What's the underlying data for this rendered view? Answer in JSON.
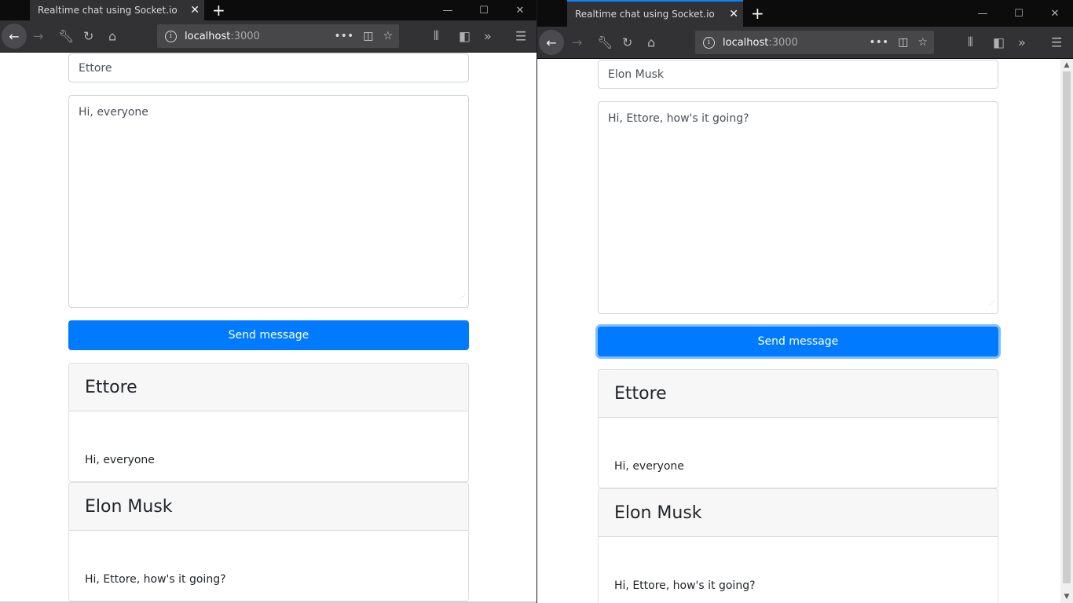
{
  "left_window": {
    "tab_title": "Realtime chat using Socket.io",
    "url_host": "localhost",
    "url_port": ":3000",
    "name_value": "Ettore",
    "message_value": "Hi, everyone",
    "send_label": "Send message",
    "messages": [
      {
        "name": "Ettore",
        "text": "Hi, everyone"
      },
      {
        "name": "Elon Musk",
        "text": "Hi, Ettore, how's it going?"
      }
    ]
  },
  "right_window": {
    "tab_title": "Realtime chat using Socket.io",
    "url_host": "localhost",
    "url_port": ":3000",
    "name_value": "Elon Musk",
    "message_value": "Hi, Ettore, how's it going?",
    "send_label": "Send message",
    "messages": [
      {
        "name": "Ettore",
        "text": "Hi, everyone"
      },
      {
        "name": "Elon Musk",
        "text": "Hi, Ettore, how's it going?"
      }
    ]
  },
  "icons": {
    "close": "close-icon",
    "new_tab": "plus-icon",
    "minimize": "minimize-icon",
    "maximize": "maximize-icon",
    "window_close": "window-close-icon",
    "back": "back-arrow-icon",
    "forward": "forward-arrow-icon",
    "tools": "wrench-icon",
    "reload": "reload-icon",
    "home": "home-icon",
    "info": "info-icon",
    "more": "more-icon",
    "pocket": "pocket-icon",
    "bookmark": "star-icon",
    "library": "library-icon",
    "sidebar": "sidebar-icon",
    "overflow": "overflow-icon",
    "menu": "hamburger-menu-icon"
  },
  "colors": {
    "primary": "#007bff",
    "chrome_dark": "#0c0c0d",
    "toolbar": "#323234",
    "urlbar": "#474749",
    "card_header": "#f7f7f7"
  }
}
